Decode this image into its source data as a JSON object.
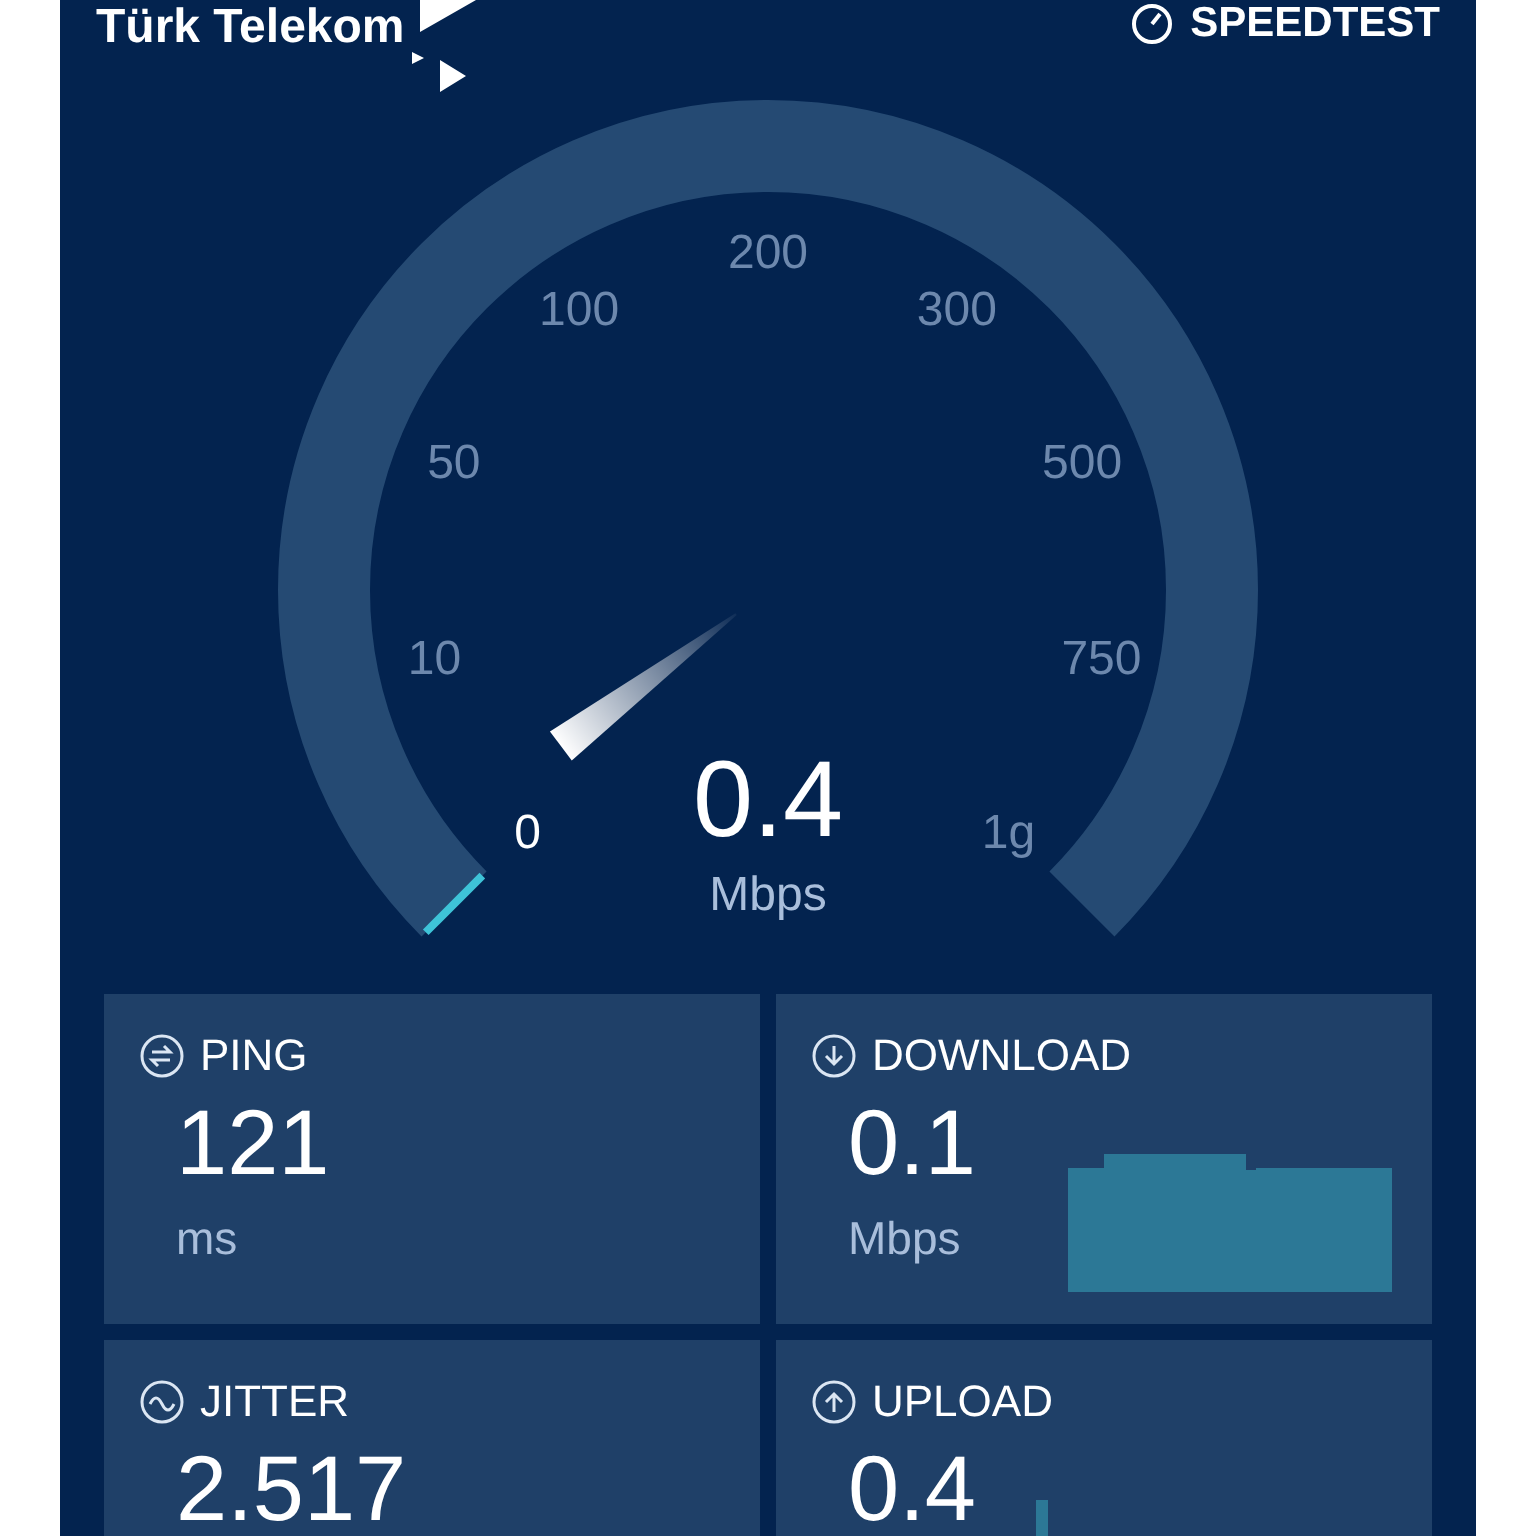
{
  "header": {
    "brand": "Türk Telekom",
    "app": "SPEEDTEST"
  },
  "gauge": {
    "scale": [
      "0",
      "10",
      "50",
      "100",
      "200",
      "300",
      "500",
      "750",
      "1g"
    ],
    "value": "0.4",
    "unit": "Mbps"
  },
  "metrics": [
    {
      "kind": "ping",
      "label": "PING",
      "value": "121",
      "unit": "ms"
    },
    {
      "kind": "download",
      "label": "DOWNLOAD",
      "value": "0.1",
      "unit": "Mbps"
    },
    {
      "kind": "jitter",
      "label": "JITTER",
      "value": "2.517"
    },
    {
      "kind": "upload",
      "label": "UPLOAD",
      "value": "0.4"
    }
  ]
}
